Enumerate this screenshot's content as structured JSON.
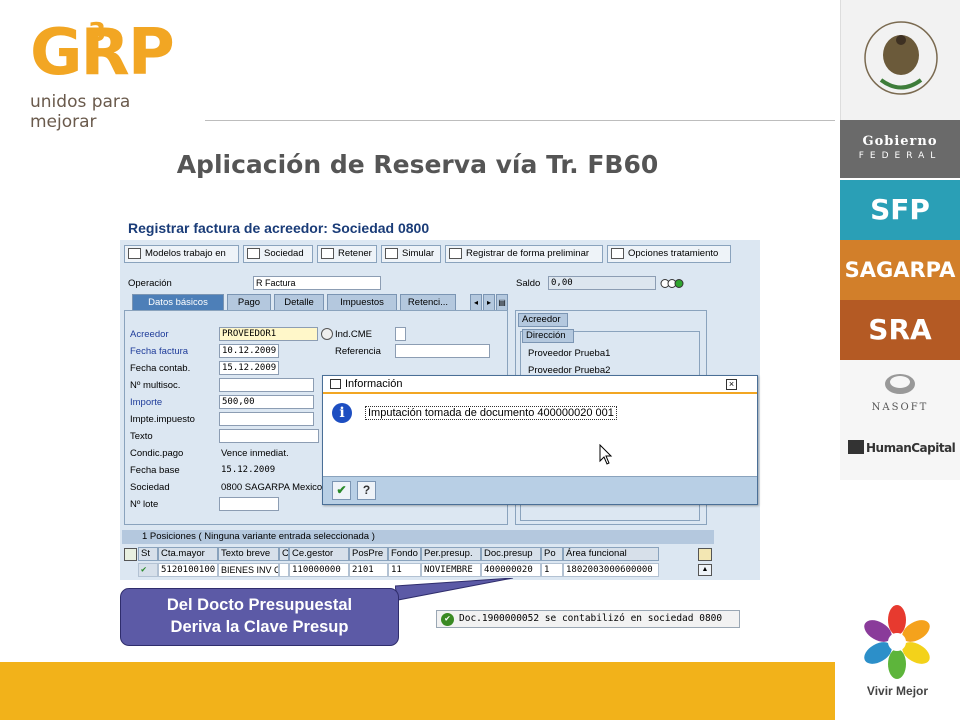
{
  "logo": {
    "mark": "GRP",
    "sup": "3",
    "tagline": "unidos para mejorar"
  },
  "slide_title": "Aplicación de Reserva vía Tr. FB60",
  "right_panel": {
    "seal_text": "ESTADOS UNIDOS MEXICANOS",
    "gobierno": "Gobierno",
    "federal": "FEDERAL",
    "agencies": [
      "SFP",
      "SAGARPA",
      "SRA"
    ],
    "nasoft": "NASOFT",
    "humancapital": "HumanCapital",
    "vivir": "Vivir Mejor"
  },
  "sap": {
    "heading": "Registrar factura de acreedor: Sociedad 0800",
    "toolbar": [
      "Modelos trabajo en",
      "Sociedad",
      "Retener",
      "Simular",
      "Registrar de forma preliminar",
      "Opciones tratamiento"
    ],
    "operacion_label": "Operación",
    "operacion_value": "R Factura",
    "saldo_label": "Saldo",
    "saldo_value": "0,00",
    "tabs": [
      "Datos básicos",
      "Pago",
      "Detalle",
      "Impuestos",
      "Retenci..."
    ],
    "fields": {
      "acreedor": {
        "label": "Acreedor",
        "value": "PROVEEDOR1"
      },
      "fecha_factura": {
        "label": "Fecha factura",
        "value": "10.12.2009"
      },
      "fecha_contab": {
        "label": "Fecha contab.",
        "value": "15.12.2009"
      },
      "multisoc": {
        "label": "Nº multisoc.",
        "value": ""
      },
      "importe": {
        "label": "Importe",
        "value": "500,00"
      },
      "impte_impuesto": {
        "label": "Impte.impuesto",
        "value": ""
      },
      "texto": {
        "label": "Texto",
        "value": ""
      },
      "condic_pago": {
        "label": "Condic.pago",
        "value": "Vence inmediat."
      },
      "fecha_base": {
        "label": "Fecha base",
        "value": "15.12.2009"
      },
      "sociedad": {
        "label": "Sociedad",
        "value": "0800 SAGARPA Mexico"
      },
      "lote": {
        "label": "Nº lote",
        "value": ""
      },
      "ind_cme": {
        "label": "Ind.CME",
        "value": ""
      },
      "referencia": {
        "label": "Referencia",
        "value": ""
      }
    },
    "acreedor_box": {
      "tab": "Acreedor",
      "subtab": "Dirección",
      "lines": [
        "Proveedor Prueba1",
        "Proveedor Prueba2"
      ]
    },
    "dialog": {
      "title": "Información",
      "message": "Imputación tomada de documento 400000020 001"
    },
    "grid": {
      "title": "1 Posiciones ( Ninguna variante entrada seleccionada )",
      "columns": [
        "St",
        "Cta.mayor",
        "Texto breve",
        "C",
        "Ce.gestor",
        "PosPre",
        "Fondo",
        "Per.presup.",
        "Doc.presup",
        "Po",
        "Área funcional"
      ],
      "row": [
        "",
        "5120100100",
        "BIENES INV C",
        "",
        "110000000",
        "2101",
        "11",
        "NOVIEMBRE",
        "400000020",
        "1",
        "1802003000600000"
      ]
    }
  },
  "callout": {
    "line1": "Del Docto Presupuestal",
    "line2": "Deriva la Clave Presup"
  },
  "status": {
    "message": "Doc.1900000052 se contabilizó en sociedad 0800"
  }
}
